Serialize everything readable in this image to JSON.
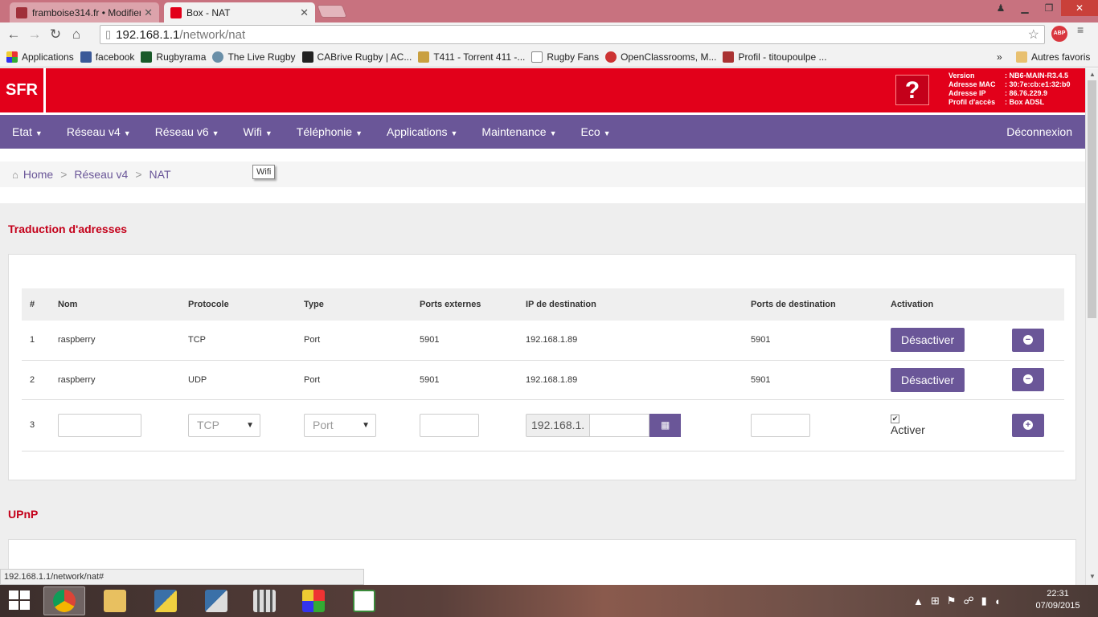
{
  "browser": {
    "tabs": [
      {
        "title": "framboise314.fr • Modifier",
        "active": false
      },
      {
        "title": "Box - NAT",
        "active": true
      }
    ],
    "url_host": "192.168.1.1",
    "url_path": "/network/nat",
    "abp_label": "ABP",
    "bookmarks": [
      {
        "label": "Applications",
        "icon": "apps-grid-icon"
      },
      {
        "label": "facebook",
        "icon": "facebook-icon"
      },
      {
        "label": "Rugbyrama",
        "icon": "rugbyrama-icon"
      },
      {
        "label": "The Live Rugby",
        "icon": "rugby-ball-icon"
      },
      {
        "label": "CABrive Rugby | AC...",
        "icon": "cabrive-icon"
      },
      {
        "label": "T411 - Torrent 411 -...",
        "icon": "t411-icon"
      },
      {
        "label": "Rugby Fans",
        "icon": "page-icon"
      },
      {
        "label": "OpenClassrooms, M...",
        "icon": "openclassrooms-icon"
      },
      {
        "label": "Profil - titoupoulpe ...",
        "icon": "profile-icon"
      }
    ],
    "bookmarks_more": "»",
    "other_bookmarks": "Autres favoris",
    "status_url": "192.168.1.1/network/nat#"
  },
  "header": {
    "logo": "SFR",
    "help": "?",
    "info": [
      {
        "key": "Version",
        "value": ": NB6-MAIN-R3.4.5"
      },
      {
        "key": "Adresse MAC",
        "value": ": 30:7e:cb:e1:32:b0"
      },
      {
        "key": "Adresse IP",
        "value": ": 86.76.229.9"
      },
      {
        "key": "Profil d'accès",
        "value": ": Box ADSL"
      }
    ]
  },
  "nav": {
    "items": [
      "Etat",
      "Réseau v4",
      "Réseau v6",
      "Wifi",
      "Téléphonie",
      "Applications",
      "Maintenance",
      "Eco"
    ],
    "logout": "Déconnexion"
  },
  "breadcrumb": {
    "home": "Home",
    "section": "Réseau v4",
    "page": "NAT",
    "sep": ">"
  },
  "tooltip": "Wifi",
  "nat": {
    "title": "Traduction d'adresses",
    "headers": [
      "#",
      "Nom",
      "Protocole",
      "Type",
      "Ports externes",
      "IP de destination",
      "Ports de destination",
      "Activation"
    ],
    "rows": [
      {
        "num": "1",
        "name": "raspberry",
        "protocol": "TCP",
        "type": "Port",
        "ext_ports": "5901",
        "dest_ip": "192.168.1.89",
        "dest_ports": "5901",
        "action": "Désactiver"
      },
      {
        "num": "2",
        "name": "raspberry",
        "protocol": "UDP",
        "type": "Port",
        "ext_ports": "5901",
        "dest_ip": "192.168.1.89",
        "dest_ports": "5901",
        "action": "Désactiver"
      }
    ],
    "new_row": {
      "num": "3",
      "protocol": "TCP",
      "type": "Port",
      "ip_prefix": "192.168.1.",
      "activate_label": "Activer",
      "activate_checked": true
    }
  },
  "upnp": {
    "title": "UPnP"
  },
  "taskbar": {
    "apps": [
      "chrome",
      "file-explorer",
      "python",
      "python-idle",
      "columns-app",
      "apps-grid",
      "visual-code"
    ],
    "time": "22:31",
    "date": "07/09/2015"
  },
  "colors": {
    "sfr_red": "#e2001a",
    "nav_purple": "#6a5698",
    "title_red": "#c4001a"
  }
}
